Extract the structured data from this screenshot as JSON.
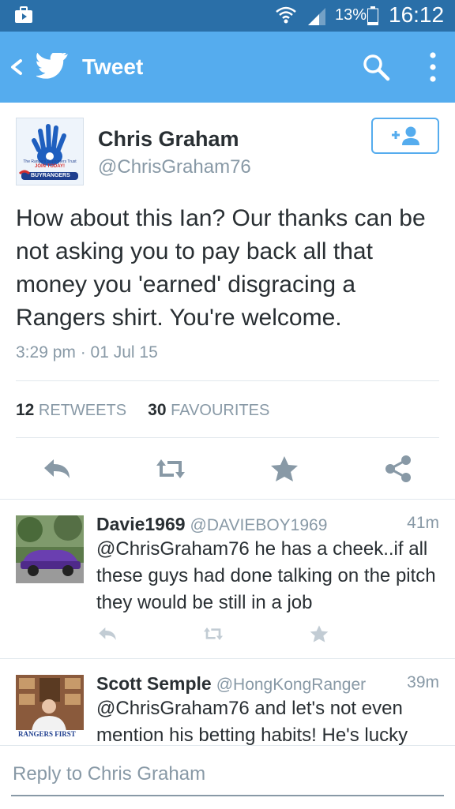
{
  "status_bar": {
    "battery_percent": "13%",
    "time": "16:12",
    "icons": [
      "briefcase-icon",
      "wifi-icon",
      "signal-icon",
      "battery-icon"
    ]
  },
  "app_bar": {
    "title": "Tweet",
    "icons": [
      "back-icon",
      "twitter-bird-icon",
      "search-icon",
      "more-vert-icon"
    ]
  },
  "tweet": {
    "name": "Chris Graham",
    "handle": "@ChrisGraham76",
    "avatar_texts": {
      "line1": "The Rangers Supporters Trust",
      "line2": "JOIN TODAY!",
      "line3": "BUYRANGERS"
    },
    "text": "How about this Ian? Our thanks can be not asking you to pay back all that money you 'earned' disgracing a Rangers shirt. You're welcome.",
    "timestamp": "3:29 pm · 01 Jul 15",
    "retweets_count": "12",
    "retweets_label": "RETWEETS",
    "favourites_count": "30",
    "favourites_label": "FAVOURITES",
    "actions": [
      "reply-icon",
      "retweet-icon",
      "favorite-icon",
      "share-icon"
    ]
  },
  "replies": [
    {
      "name": "Davie1969",
      "handle": "@DAVIEBOY1969",
      "time": "41m",
      "text": "@ChrisGraham76 he has a cheek..if all these guys had done talking on the pitch they would be still in a job"
    },
    {
      "name": "Scott Semple",
      "handle": "@HongKongRanger",
      "time": "39m",
      "text": "@ChrisGraham76 and let's not even mention his betting habits! He's lucky",
      "avatar_text": "RANGERS FIRST"
    }
  ],
  "reply_box": {
    "placeholder": "Reply to Chris Graham"
  },
  "colors": {
    "status_bar": "#2a6fa8",
    "app_bar": "#55acee",
    "text": "#292f33",
    "muted": "#8899a6"
  }
}
